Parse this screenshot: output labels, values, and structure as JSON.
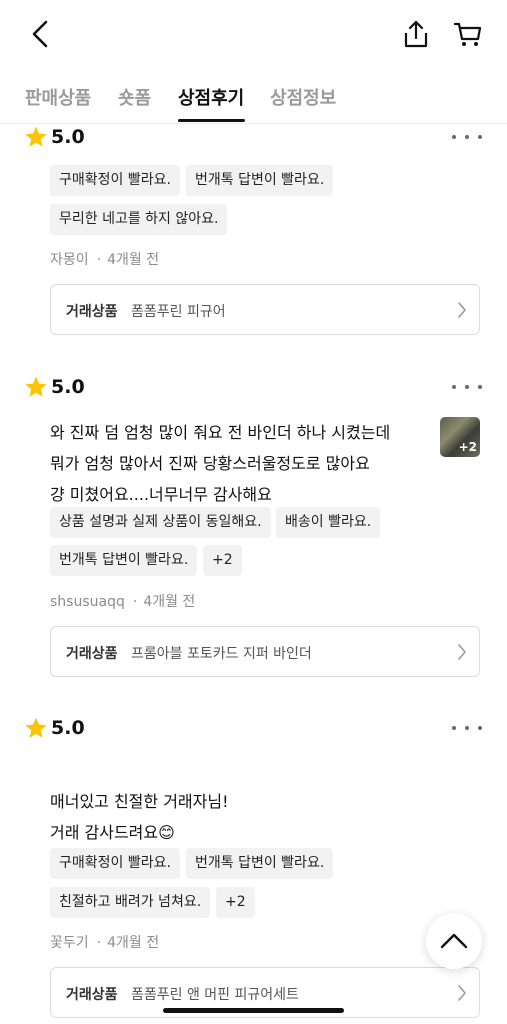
{
  "header": {
    "back_icon": "chevron-left-icon",
    "share_icon": "share-icon",
    "cart_icon": "cart-icon"
  },
  "tabs": [
    {
      "label": "판매상품",
      "active": false
    },
    {
      "label": "숏폼",
      "active": false
    },
    {
      "label": "상점후기",
      "active": true
    },
    {
      "label": "상점정보",
      "active": false
    }
  ],
  "item_label": "거래상품",
  "reviews": [
    {
      "rating": "5.0",
      "text_lines": [],
      "tags": [
        "구매확정이 빨라요.",
        "번개톡 답변이 빨라요.",
        "무리한 네고를 하지 않아요."
      ],
      "author": "자몽이",
      "date": "4개월 전",
      "item": "폼폼푸린 피규어"
    },
    {
      "rating": "5.0",
      "text_lines": [
        "와 진짜 덤 엄청 많이 줘요 전 바인더 하나 시켰는데",
        "뭐가 엄청 많아서 진짜 당황스러울정도로 많아요",
        "걍 미쳤어요....너무너무 감사해요"
      ],
      "photo_extra": "+2",
      "tags": [
        "상품 설명과 실제 상품이 동일해요.",
        "배송이 빨라요.",
        "번개톡 답변이 빨라요.",
        "+2"
      ],
      "author": "shsusuaqq",
      "date": "4개월 전",
      "item": "프롬아블 포토카드 지퍼 바인더"
    },
    {
      "rating": "5.0",
      "text_lines": [
        "매너있고 친절한 거래자님!",
        "거래 감사드려요😊"
      ],
      "tags": [
        "구매확정이 빨라요.",
        "번개톡 답변이 빨라요.",
        "친절하고 배려가 넘쳐요.",
        "+2"
      ],
      "author": "꽃두기",
      "date": "4개월 전",
      "item": "폼폼푸린 앤 머핀 피규어세트"
    }
  ],
  "colors": {
    "star": "#FFC400",
    "tag_bg": "#F2F2F2",
    "text": "#111111",
    "muted": "#8C8C8C"
  }
}
